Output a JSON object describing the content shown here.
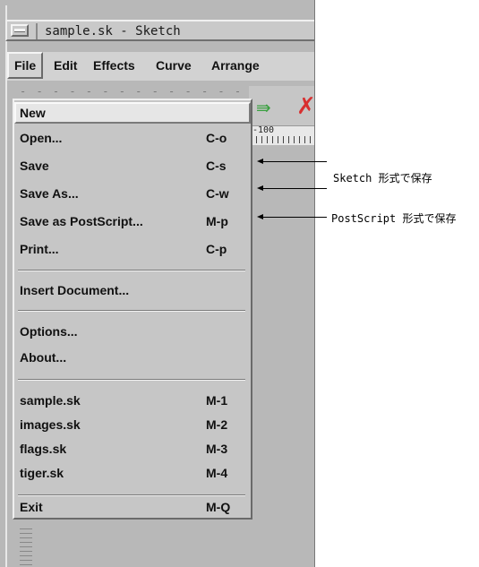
{
  "window": {
    "title": "sample.sk - Sketch"
  },
  "menubar": {
    "items": [
      "File",
      "Edit",
      "Effects",
      "Curve",
      "Arrange"
    ]
  },
  "menu": {
    "tearoff": "- - - - - - - - - - - - - - - -",
    "items": [
      {
        "label": "New",
        "accel": ""
      },
      {
        "label": "Open...",
        "accel": "C-o"
      },
      {
        "label": "Save",
        "accel": "C-s"
      },
      {
        "label": "Save As...",
        "accel": "C-w"
      },
      {
        "label": "Save as PostScript...",
        "accel": "M-p"
      },
      {
        "label": "Print...",
        "accel": "C-p"
      },
      {
        "label": "Insert Document...",
        "accel": ""
      },
      {
        "label": "Options...",
        "accel": ""
      },
      {
        "label": "About...",
        "accel": ""
      },
      {
        "label": "sample.sk",
        "accel": "M-1"
      },
      {
        "label": "images.sk",
        "accel": "M-2"
      },
      {
        "label": "flags.sk",
        "accel": "M-3"
      },
      {
        "label": "tiger.sk",
        "accel": "M-4"
      },
      {
        "label": "Exit",
        "accel": "M-Q"
      }
    ]
  },
  "ruler": {
    "label": "-100"
  },
  "toolbar": {
    "icons": [
      "redo-arrow-icon",
      "delete-x-icon"
    ],
    "colors": {
      "redo": "#3aa040",
      "delete": "#d83030"
    }
  },
  "annotations": {
    "sketch_save": "Sketch 形式で保存",
    "postscript_save": "PostScript 形式で保存"
  }
}
